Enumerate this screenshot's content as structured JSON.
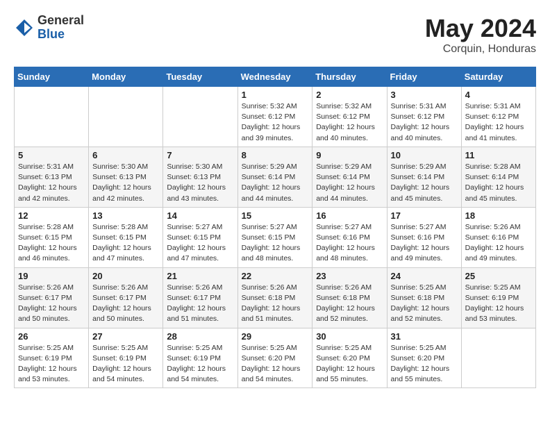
{
  "header": {
    "logo_general": "General",
    "logo_blue": "Blue",
    "month_year": "May 2024",
    "location": "Corquin, Honduras"
  },
  "days_of_week": [
    "Sunday",
    "Monday",
    "Tuesday",
    "Wednesday",
    "Thursday",
    "Friday",
    "Saturday"
  ],
  "weeks": [
    [
      {
        "day": "",
        "info": ""
      },
      {
        "day": "",
        "info": ""
      },
      {
        "day": "",
        "info": ""
      },
      {
        "day": "1",
        "info": "Sunrise: 5:32 AM\nSunset: 6:12 PM\nDaylight: 12 hours\nand 39 minutes."
      },
      {
        "day": "2",
        "info": "Sunrise: 5:32 AM\nSunset: 6:12 PM\nDaylight: 12 hours\nand 40 minutes."
      },
      {
        "day": "3",
        "info": "Sunrise: 5:31 AM\nSunset: 6:12 PM\nDaylight: 12 hours\nand 40 minutes."
      },
      {
        "day": "4",
        "info": "Sunrise: 5:31 AM\nSunset: 6:12 PM\nDaylight: 12 hours\nand 41 minutes."
      }
    ],
    [
      {
        "day": "5",
        "info": "Sunrise: 5:31 AM\nSunset: 6:13 PM\nDaylight: 12 hours\nand 42 minutes."
      },
      {
        "day": "6",
        "info": "Sunrise: 5:30 AM\nSunset: 6:13 PM\nDaylight: 12 hours\nand 42 minutes."
      },
      {
        "day": "7",
        "info": "Sunrise: 5:30 AM\nSunset: 6:13 PM\nDaylight: 12 hours\nand 43 minutes."
      },
      {
        "day": "8",
        "info": "Sunrise: 5:29 AM\nSunset: 6:14 PM\nDaylight: 12 hours\nand 44 minutes."
      },
      {
        "day": "9",
        "info": "Sunrise: 5:29 AM\nSunset: 6:14 PM\nDaylight: 12 hours\nand 44 minutes."
      },
      {
        "day": "10",
        "info": "Sunrise: 5:29 AM\nSunset: 6:14 PM\nDaylight: 12 hours\nand 45 minutes."
      },
      {
        "day": "11",
        "info": "Sunrise: 5:28 AM\nSunset: 6:14 PM\nDaylight: 12 hours\nand 45 minutes."
      }
    ],
    [
      {
        "day": "12",
        "info": "Sunrise: 5:28 AM\nSunset: 6:15 PM\nDaylight: 12 hours\nand 46 minutes."
      },
      {
        "day": "13",
        "info": "Sunrise: 5:28 AM\nSunset: 6:15 PM\nDaylight: 12 hours\nand 47 minutes."
      },
      {
        "day": "14",
        "info": "Sunrise: 5:27 AM\nSunset: 6:15 PM\nDaylight: 12 hours\nand 47 minutes."
      },
      {
        "day": "15",
        "info": "Sunrise: 5:27 AM\nSunset: 6:15 PM\nDaylight: 12 hours\nand 48 minutes."
      },
      {
        "day": "16",
        "info": "Sunrise: 5:27 AM\nSunset: 6:16 PM\nDaylight: 12 hours\nand 48 minutes."
      },
      {
        "day": "17",
        "info": "Sunrise: 5:27 AM\nSunset: 6:16 PM\nDaylight: 12 hours\nand 49 minutes."
      },
      {
        "day": "18",
        "info": "Sunrise: 5:26 AM\nSunset: 6:16 PM\nDaylight: 12 hours\nand 49 minutes."
      }
    ],
    [
      {
        "day": "19",
        "info": "Sunrise: 5:26 AM\nSunset: 6:17 PM\nDaylight: 12 hours\nand 50 minutes."
      },
      {
        "day": "20",
        "info": "Sunrise: 5:26 AM\nSunset: 6:17 PM\nDaylight: 12 hours\nand 50 minutes."
      },
      {
        "day": "21",
        "info": "Sunrise: 5:26 AM\nSunset: 6:17 PM\nDaylight: 12 hours\nand 51 minutes."
      },
      {
        "day": "22",
        "info": "Sunrise: 5:26 AM\nSunset: 6:18 PM\nDaylight: 12 hours\nand 51 minutes."
      },
      {
        "day": "23",
        "info": "Sunrise: 5:26 AM\nSunset: 6:18 PM\nDaylight: 12 hours\nand 52 minutes."
      },
      {
        "day": "24",
        "info": "Sunrise: 5:25 AM\nSunset: 6:18 PM\nDaylight: 12 hours\nand 52 minutes."
      },
      {
        "day": "25",
        "info": "Sunrise: 5:25 AM\nSunset: 6:19 PM\nDaylight: 12 hours\nand 53 minutes."
      }
    ],
    [
      {
        "day": "26",
        "info": "Sunrise: 5:25 AM\nSunset: 6:19 PM\nDaylight: 12 hours\nand 53 minutes."
      },
      {
        "day": "27",
        "info": "Sunrise: 5:25 AM\nSunset: 6:19 PM\nDaylight: 12 hours\nand 54 minutes."
      },
      {
        "day": "28",
        "info": "Sunrise: 5:25 AM\nSunset: 6:19 PM\nDaylight: 12 hours\nand 54 minutes."
      },
      {
        "day": "29",
        "info": "Sunrise: 5:25 AM\nSunset: 6:20 PM\nDaylight: 12 hours\nand 54 minutes."
      },
      {
        "day": "30",
        "info": "Sunrise: 5:25 AM\nSunset: 6:20 PM\nDaylight: 12 hours\nand 55 minutes."
      },
      {
        "day": "31",
        "info": "Sunrise: 5:25 AM\nSunset: 6:20 PM\nDaylight: 12 hours\nand 55 minutes."
      },
      {
        "day": "",
        "info": ""
      }
    ]
  ]
}
